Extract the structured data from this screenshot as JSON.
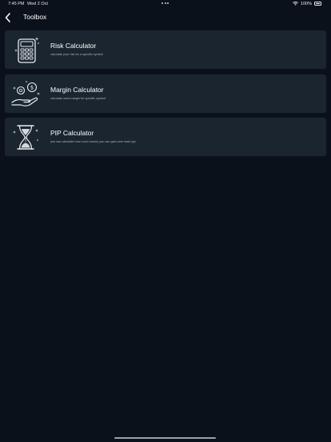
{
  "status_bar": {
    "time": "7:45 PM",
    "date": "Wed 2 Oct",
    "battery": "100%",
    "battery_level": 1.0
  },
  "nav": {
    "back_icon": "chevron-left-icon",
    "title": "Toolbox"
  },
  "tools": [
    {
      "title": "Risk Calculator",
      "subtitle": "calculate your risk for a specific symbol",
      "icon": "calculator-icon"
    },
    {
      "title": "Margin Calculator",
      "subtitle": "calculate used margin for specific symbol",
      "icon": "hand-coins-icon"
    },
    {
      "title": "PIP Calculator",
      "subtitle": "you can calculate how much money you can gain over each pip",
      "icon": "hourglass-icon"
    }
  ],
  "colors": {
    "background": "#0b111a",
    "card": "#1b2530",
    "title_text": "#ffffff",
    "subtitle_text": "#aab2bd"
  }
}
